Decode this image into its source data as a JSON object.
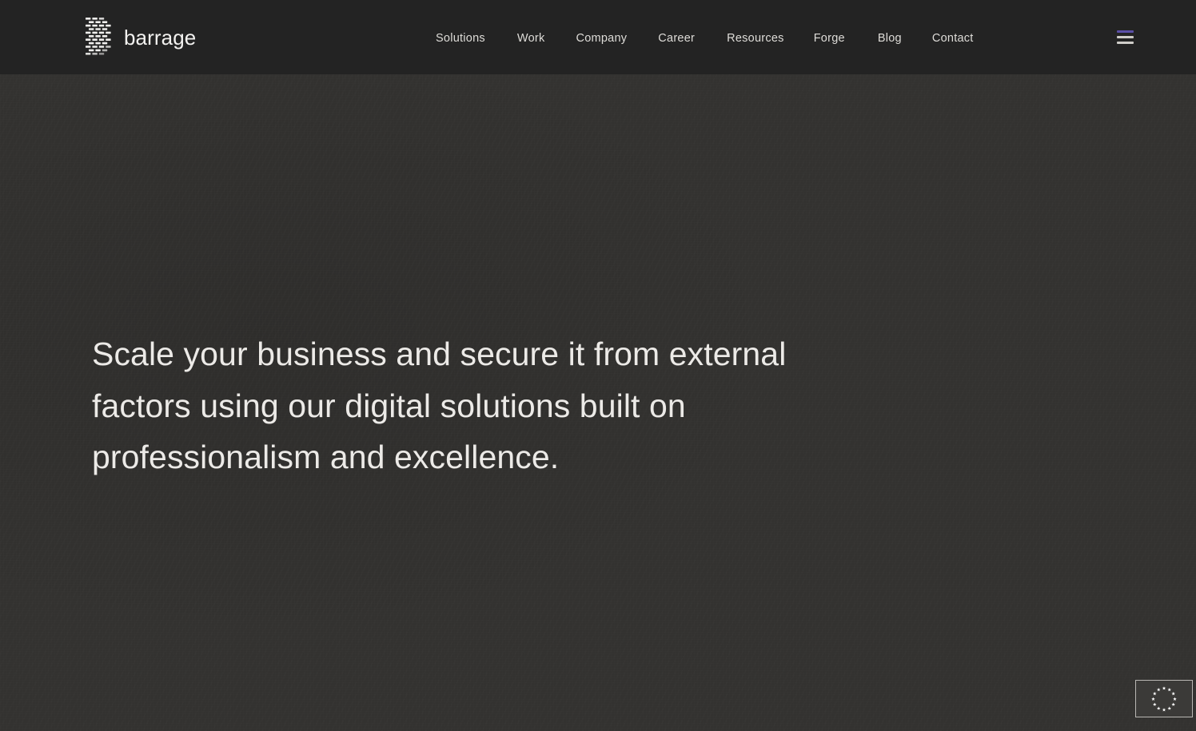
{
  "theme": {
    "header_bg": "#232323",
    "hero_bg": "#333230",
    "text_primary": "#eceae7",
    "text_nav": "#dedcd8",
    "accent_purple": "#5b4fa8",
    "badge_border": "#b9b7b3"
  },
  "header": {
    "brand": {
      "wordmark": "barrage",
      "logo_icon": "barrage-brick-dash-logo-icon"
    },
    "nav": [
      {
        "label": "Solutions"
      },
      {
        "label": "Work"
      },
      {
        "label": "Company"
      },
      {
        "label": "Career"
      },
      {
        "label": "Resources"
      },
      {
        "label": "Forge"
      },
      {
        "label": "Blog"
      },
      {
        "label": "Contact"
      }
    ],
    "menu_toggle": {
      "icon": "hamburger-menu-icon",
      "aria_label": "Open menu"
    }
  },
  "hero": {
    "headline_lines": [
      "Scale your business and secure it from external",
      "factors using our digital solutions built on",
      "professionalism and excellence."
    ]
  },
  "badge": {
    "icon": "eu-stars-circle-icon",
    "aria_label": "EU"
  }
}
